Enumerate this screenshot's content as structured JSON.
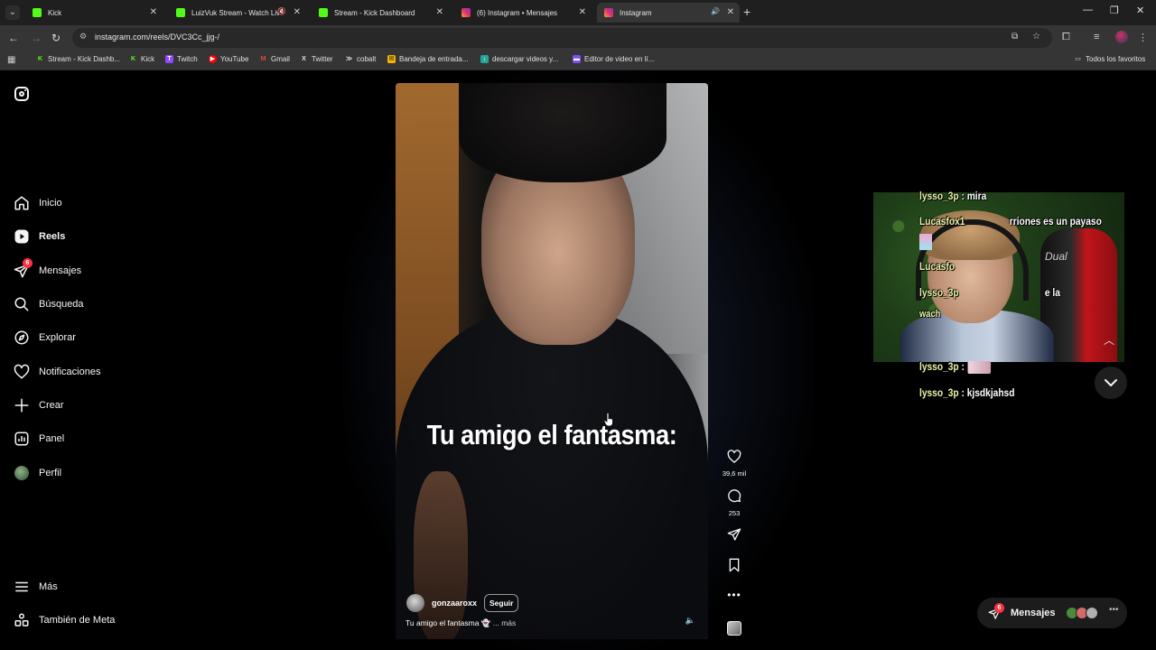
{
  "browser": {
    "tabs": [
      {
        "title": "Kick",
        "fav_color": "#53fc18",
        "active": false
      },
      {
        "title": "LuizVuk Stream - Watch Live",
        "fav_color": "#53fc18",
        "active": false
      },
      {
        "title": "Stream - Kick Dashboard",
        "fav_color": "#53fc18",
        "active": false
      },
      {
        "title": "(6) Instagram • Mensajes",
        "fav_color": "#e1306c",
        "active": false
      },
      {
        "title": "Instagram",
        "fav_color": "#e1306c",
        "active": true
      }
    ],
    "url": "instagram.com/reels/DVC3Cc_jjg-/",
    "bookmarks": [
      {
        "label": "Stream - Kick Dashb...",
        "color": "#53fc18",
        "glyph": "K"
      },
      {
        "label": "Kick",
        "color": "#53fc18",
        "glyph": "K"
      },
      {
        "label": "Twitch",
        "color": "#9146ff",
        "glyph": "T"
      },
      {
        "label": "YouTube",
        "color": "#ff0000",
        "glyph": "▶"
      },
      {
        "label": "Gmail",
        "color": "#ea4335",
        "glyph": "M"
      },
      {
        "label": "Twitter",
        "color": "#e7e7e7",
        "glyph": "X"
      },
      {
        "label": "cobalt",
        "color": "#e7e7e7",
        "glyph": "≫"
      },
      {
        "label": "Bandeja de entrada...",
        "color": "#f4b400",
        "glyph": "✉"
      },
      {
        "label": "descargar videos y...",
        "color": "#26a69a",
        "glyph": "↓"
      },
      {
        "label": "Editor de video en lí...",
        "color": "#7c4dff",
        "glyph": "▬"
      }
    ],
    "all_bookmarks_label": "Todos los favoritos"
  },
  "sidebar": {
    "items": [
      {
        "label": "Inicio",
        "icon": "home-icon"
      },
      {
        "label": "Reels",
        "icon": "reels-icon"
      },
      {
        "label": "Mensajes",
        "icon": "messages-icon",
        "badge": "6"
      },
      {
        "label": "Búsqueda",
        "icon": "search-icon"
      },
      {
        "label": "Explorar",
        "icon": "explore-icon"
      },
      {
        "label": "Notificaciones",
        "icon": "heart-icon"
      },
      {
        "label": "Crear",
        "icon": "plus-icon"
      },
      {
        "label": "Panel",
        "icon": "chart-icon"
      },
      {
        "label": "Perfil",
        "icon": "profile-avatar"
      }
    ],
    "more_label": "Más",
    "meta_label": "También de Meta"
  },
  "reel": {
    "overlay_text": "Tu amigo el fantasma:",
    "username": "gonzaaroxx",
    "follow_label": "Seguir",
    "caption": "Tu amigo el fantasma 👻",
    "more_label": "... más",
    "likes": "39,6 mil",
    "comments": "253"
  },
  "stream_overlay": {
    "chair_text": "Dual",
    "chat": [
      {
        "user": "lysso_3p",
        "text": ": mira"
      },
      {
        "user": "Lucasfox1",
        "text": "rriones es un payaso"
      },
      {
        "user": "Lucasfo",
        "text": ""
      },
      {
        "user": "lysso_3p",
        "text": "e la"
      },
      {
        "user": "wach",
        "text": ""
      },
      {
        "user": "lysso_3p",
        "text": ":"
      },
      {
        "user": "lysso_3p",
        "text": ": kjsdkjahsd"
      }
    ]
  },
  "messages_pill": {
    "label": "Mensajes",
    "badge": "6",
    "avatar_colors": [
      "#4a8a3a",
      "#d46a6a",
      "#b0b0b0"
    ]
  }
}
